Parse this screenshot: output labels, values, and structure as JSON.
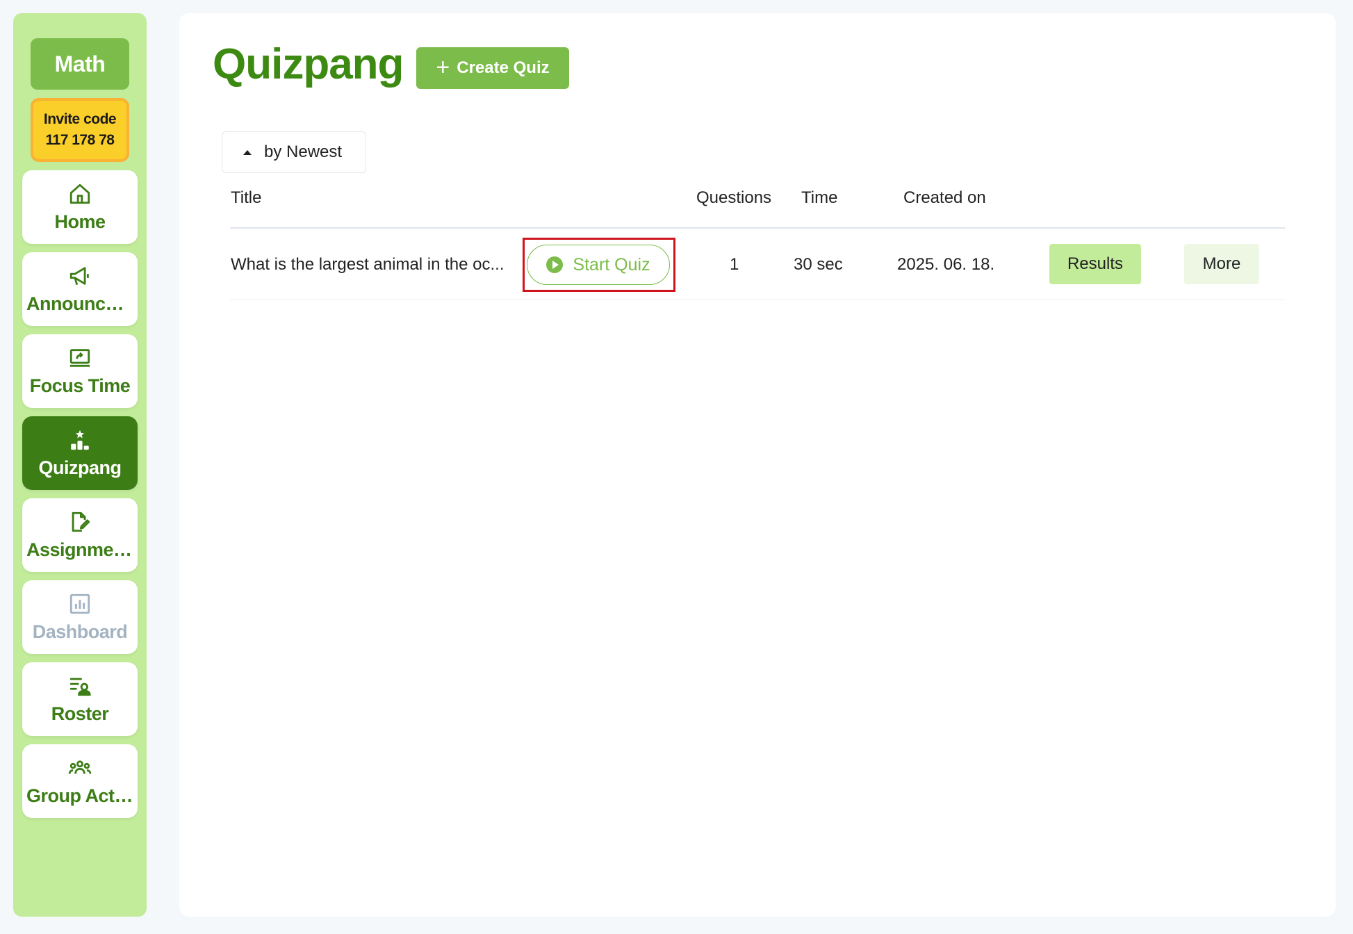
{
  "sidebar": {
    "class_name": "Math",
    "invite_label": "Invite code",
    "invite_code": "117 178 78",
    "items": [
      {
        "label": "Home",
        "icon": "home-icon"
      },
      {
        "label": "Announcements",
        "icon": "megaphone-icon"
      },
      {
        "label": "Focus Time",
        "icon": "screen-share-icon"
      },
      {
        "label": "Quizpang",
        "icon": "podium-star-icon",
        "active": true
      },
      {
        "label": "Assignments",
        "icon": "document-edit-icon"
      },
      {
        "label": "Dashboard",
        "icon": "bar-chart-icon",
        "disabled": true
      },
      {
        "label": "Roster",
        "icon": "roster-list-icon"
      },
      {
        "label": "Group Activities",
        "icon": "group-icon"
      }
    ]
  },
  "main": {
    "title": "Quizpang",
    "create_button": "Create Quiz",
    "sort_label": "by Newest",
    "columns": {
      "title": "Title",
      "questions": "Questions",
      "time": "Time",
      "created_on": "Created on"
    },
    "quizzes": [
      {
        "title": "What is the largest animal in the oc...",
        "start_label": "Start Quiz",
        "questions": "1",
        "time": "30 sec",
        "created_on": "2025. 06. 18.",
        "results_label": "Results",
        "more_label": "More"
      }
    ]
  },
  "colors": {
    "brand_green": "#3d8a12",
    "accent_green": "#7cbc4a",
    "sidebar_bg": "#c2eb9a",
    "invite_yellow": "#fbcf2a",
    "highlight_red": "#d0141c"
  }
}
